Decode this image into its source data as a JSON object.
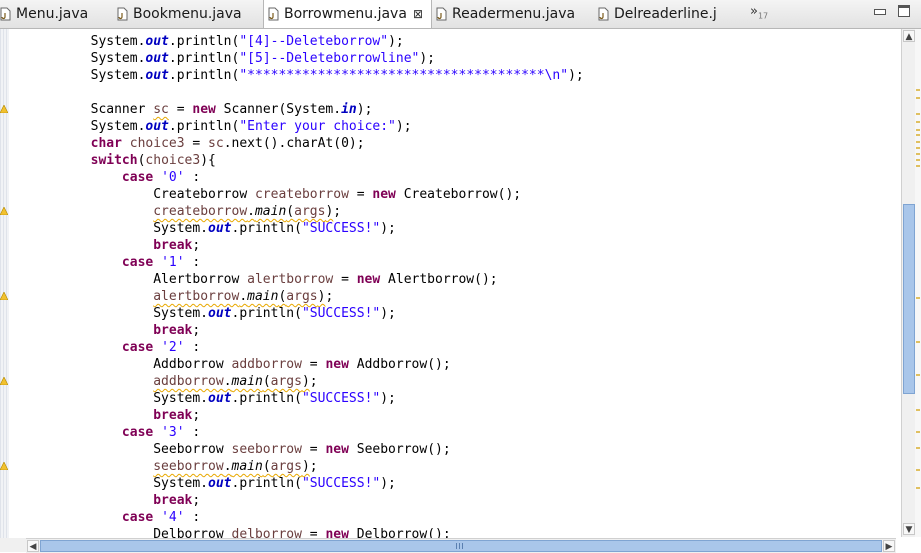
{
  "tabs": [
    {
      "label": "Menu.java",
      "active": false
    },
    {
      "label": "Bookmenu.java",
      "active": false
    },
    {
      "label": "Borrowmenu.java",
      "active": true
    },
    {
      "label": "Readermenu.java",
      "active": false
    },
    {
      "label": "Delreaderline.j",
      "active": false
    }
  ],
  "overflow": {
    "arrows": "»",
    "count": "17"
  },
  "colors": {
    "keyword": "#7f0055",
    "static_field": "#0000c0",
    "string": "#2a00ff",
    "local_variable": "#6a3e3e",
    "scroll_thumb": "#a9c6ea"
  },
  "code_lines": [
    [
      {
        "t": "        System."
      },
      {
        "t": "out",
        "c": "st"
      },
      {
        "t": ".println("
      },
      {
        "t": "\"[4]--Deleteborrow\"",
        "c": "str"
      },
      {
        "t": ");"
      }
    ],
    [
      {
        "t": "        System."
      },
      {
        "t": "out",
        "c": "st"
      },
      {
        "t": ".println("
      },
      {
        "t": "\"[5]--Deleteborrowline\"",
        "c": "str"
      },
      {
        "t": ");"
      }
    ],
    [
      {
        "t": "        System."
      },
      {
        "t": "out",
        "c": "st"
      },
      {
        "t": ".println("
      },
      {
        "t": "\"**************************************\\n\"",
        "c": "str"
      },
      {
        "t": ");"
      }
    ],
    [
      {
        "t": ""
      }
    ],
    [
      {
        "t": "        Scanner "
      },
      {
        "t": "sc",
        "c": "var sq"
      },
      {
        "t": " = "
      },
      {
        "t": "new",
        "c": "kw"
      },
      {
        "t": " Scanner(System."
      },
      {
        "t": "in",
        "c": "st"
      },
      {
        "t": ");"
      }
    ],
    [
      {
        "t": "        System."
      },
      {
        "t": "out",
        "c": "st"
      },
      {
        "t": ".println("
      },
      {
        "t": "\"Enter your choice:\"",
        "c": "str"
      },
      {
        "t": ");"
      }
    ],
    [
      {
        "t": "        "
      },
      {
        "t": "char",
        "c": "kw"
      },
      {
        "t": " "
      },
      {
        "t": "choice3",
        "c": "var"
      },
      {
        "t": " = "
      },
      {
        "t": "sc",
        "c": "var"
      },
      {
        "t": ".next().charAt(0);"
      }
    ],
    [
      {
        "t": "        "
      },
      {
        "t": "switch",
        "c": "kw"
      },
      {
        "t": "("
      },
      {
        "t": "choice3",
        "c": "var"
      },
      {
        "t": "){"
      }
    ],
    [
      {
        "t": "            "
      },
      {
        "t": "case",
        "c": "kw"
      },
      {
        "t": " "
      },
      {
        "t": "'0'",
        "c": "str"
      },
      {
        "t": " :"
      }
    ],
    [
      {
        "t": "                Createborrow "
      },
      {
        "t": "createborrow",
        "c": "var"
      },
      {
        "t": " = "
      },
      {
        "t": "new",
        "c": "kw"
      },
      {
        "t": " Createborrow();"
      }
    ],
    [
      {
        "t": "                "
      },
      {
        "t": "createborrow",
        "c": "var sq"
      },
      {
        "t": ".",
        "c": "sq"
      },
      {
        "t": "main",
        "c": "it sq"
      },
      {
        "t": "(",
        "c": "sq"
      },
      {
        "t": "args",
        "c": "var sq"
      },
      {
        "t": ")",
        "c": "sq"
      },
      {
        "t": ";"
      }
    ],
    [
      {
        "t": "                System."
      },
      {
        "t": "out",
        "c": "st"
      },
      {
        "t": ".println("
      },
      {
        "t": "\"SUCCESS!\"",
        "c": "str"
      },
      {
        "t": ");"
      }
    ],
    [
      {
        "t": "                "
      },
      {
        "t": "break",
        "c": "kw"
      },
      {
        "t": ";"
      }
    ],
    [
      {
        "t": "            "
      },
      {
        "t": "case",
        "c": "kw"
      },
      {
        "t": " "
      },
      {
        "t": "'1'",
        "c": "str"
      },
      {
        "t": " :"
      }
    ],
    [
      {
        "t": "                Alertborrow "
      },
      {
        "t": "alertborrow",
        "c": "var"
      },
      {
        "t": " = "
      },
      {
        "t": "new",
        "c": "kw"
      },
      {
        "t": " Alertborrow();"
      }
    ],
    [
      {
        "t": "                "
      },
      {
        "t": "alertborrow",
        "c": "var sq"
      },
      {
        "t": ".",
        "c": "sq"
      },
      {
        "t": "main",
        "c": "it sq"
      },
      {
        "t": "(",
        "c": "sq"
      },
      {
        "t": "args",
        "c": "var sq"
      },
      {
        "t": ")",
        "c": "sq"
      },
      {
        "t": ";"
      }
    ],
    [
      {
        "t": "                System."
      },
      {
        "t": "out",
        "c": "st"
      },
      {
        "t": ".println("
      },
      {
        "t": "\"SUCCESS!\"",
        "c": "str"
      },
      {
        "t": ");"
      }
    ],
    [
      {
        "t": "                "
      },
      {
        "t": "break",
        "c": "kw"
      },
      {
        "t": ";"
      }
    ],
    [
      {
        "t": "            "
      },
      {
        "t": "case",
        "c": "kw"
      },
      {
        "t": " "
      },
      {
        "t": "'2'",
        "c": "str"
      },
      {
        "t": " :"
      }
    ],
    [
      {
        "t": "                Addborrow "
      },
      {
        "t": "addborrow",
        "c": "var"
      },
      {
        "t": " = "
      },
      {
        "t": "new",
        "c": "kw"
      },
      {
        "t": " Addborrow();"
      }
    ],
    [
      {
        "t": "                "
      },
      {
        "t": "addborrow",
        "c": "var sq"
      },
      {
        "t": ".",
        "c": "sq"
      },
      {
        "t": "main",
        "c": "it sq"
      },
      {
        "t": "(",
        "c": "sq"
      },
      {
        "t": "args",
        "c": "var sq"
      },
      {
        "t": ")",
        "c": "sq"
      },
      {
        "t": ";"
      }
    ],
    [
      {
        "t": "                System."
      },
      {
        "t": "out",
        "c": "st"
      },
      {
        "t": ".println("
      },
      {
        "t": "\"SUCCESS!\"",
        "c": "str"
      },
      {
        "t": ");"
      }
    ],
    [
      {
        "t": "                "
      },
      {
        "t": "break",
        "c": "kw"
      },
      {
        "t": ";"
      }
    ],
    [
      {
        "t": "            "
      },
      {
        "t": "case",
        "c": "kw"
      },
      {
        "t": " "
      },
      {
        "t": "'3'",
        "c": "str"
      },
      {
        "t": " :"
      }
    ],
    [
      {
        "t": "                Seeborrow "
      },
      {
        "t": "seeborrow",
        "c": "var"
      },
      {
        "t": " = "
      },
      {
        "t": "new",
        "c": "kw"
      },
      {
        "t": " Seeborrow();"
      }
    ],
    [
      {
        "t": "                "
      },
      {
        "t": "seeborrow",
        "c": "var sq"
      },
      {
        "t": ".",
        "c": "sq"
      },
      {
        "t": "main",
        "c": "it sq"
      },
      {
        "t": "(",
        "c": "sq"
      },
      {
        "t": "args",
        "c": "var sq"
      },
      {
        "t": ")",
        "c": "sq"
      },
      {
        "t": ";"
      }
    ],
    [
      {
        "t": "                System."
      },
      {
        "t": "out",
        "c": "st"
      },
      {
        "t": ".println("
      },
      {
        "t": "\"SUCCESS!\"",
        "c": "str"
      },
      {
        "t": ");"
      }
    ],
    [
      {
        "t": "                "
      },
      {
        "t": "break",
        "c": "kw"
      },
      {
        "t": ";"
      }
    ],
    [
      {
        "t": "            "
      },
      {
        "t": "case",
        "c": "kw"
      },
      {
        "t": " "
      },
      {
        "t": "'4'",
        "c": "str"
      },
      {
        "t": " :"
      }
    ],
    [
      {
        "t": "                Delborrow "
      },
      {
        "t": "delborrow",
        "c": "var"
      },
      {
        "t": " = "
      },
      {
        "t": "new",
        "c": "kw"
      },
      {
        "t": " Delborrow();"
      }
    ]
  ],
  "scroll": {
    "vertical_position": 0.56,
    "horizontal_position": 0.0
  }
}
